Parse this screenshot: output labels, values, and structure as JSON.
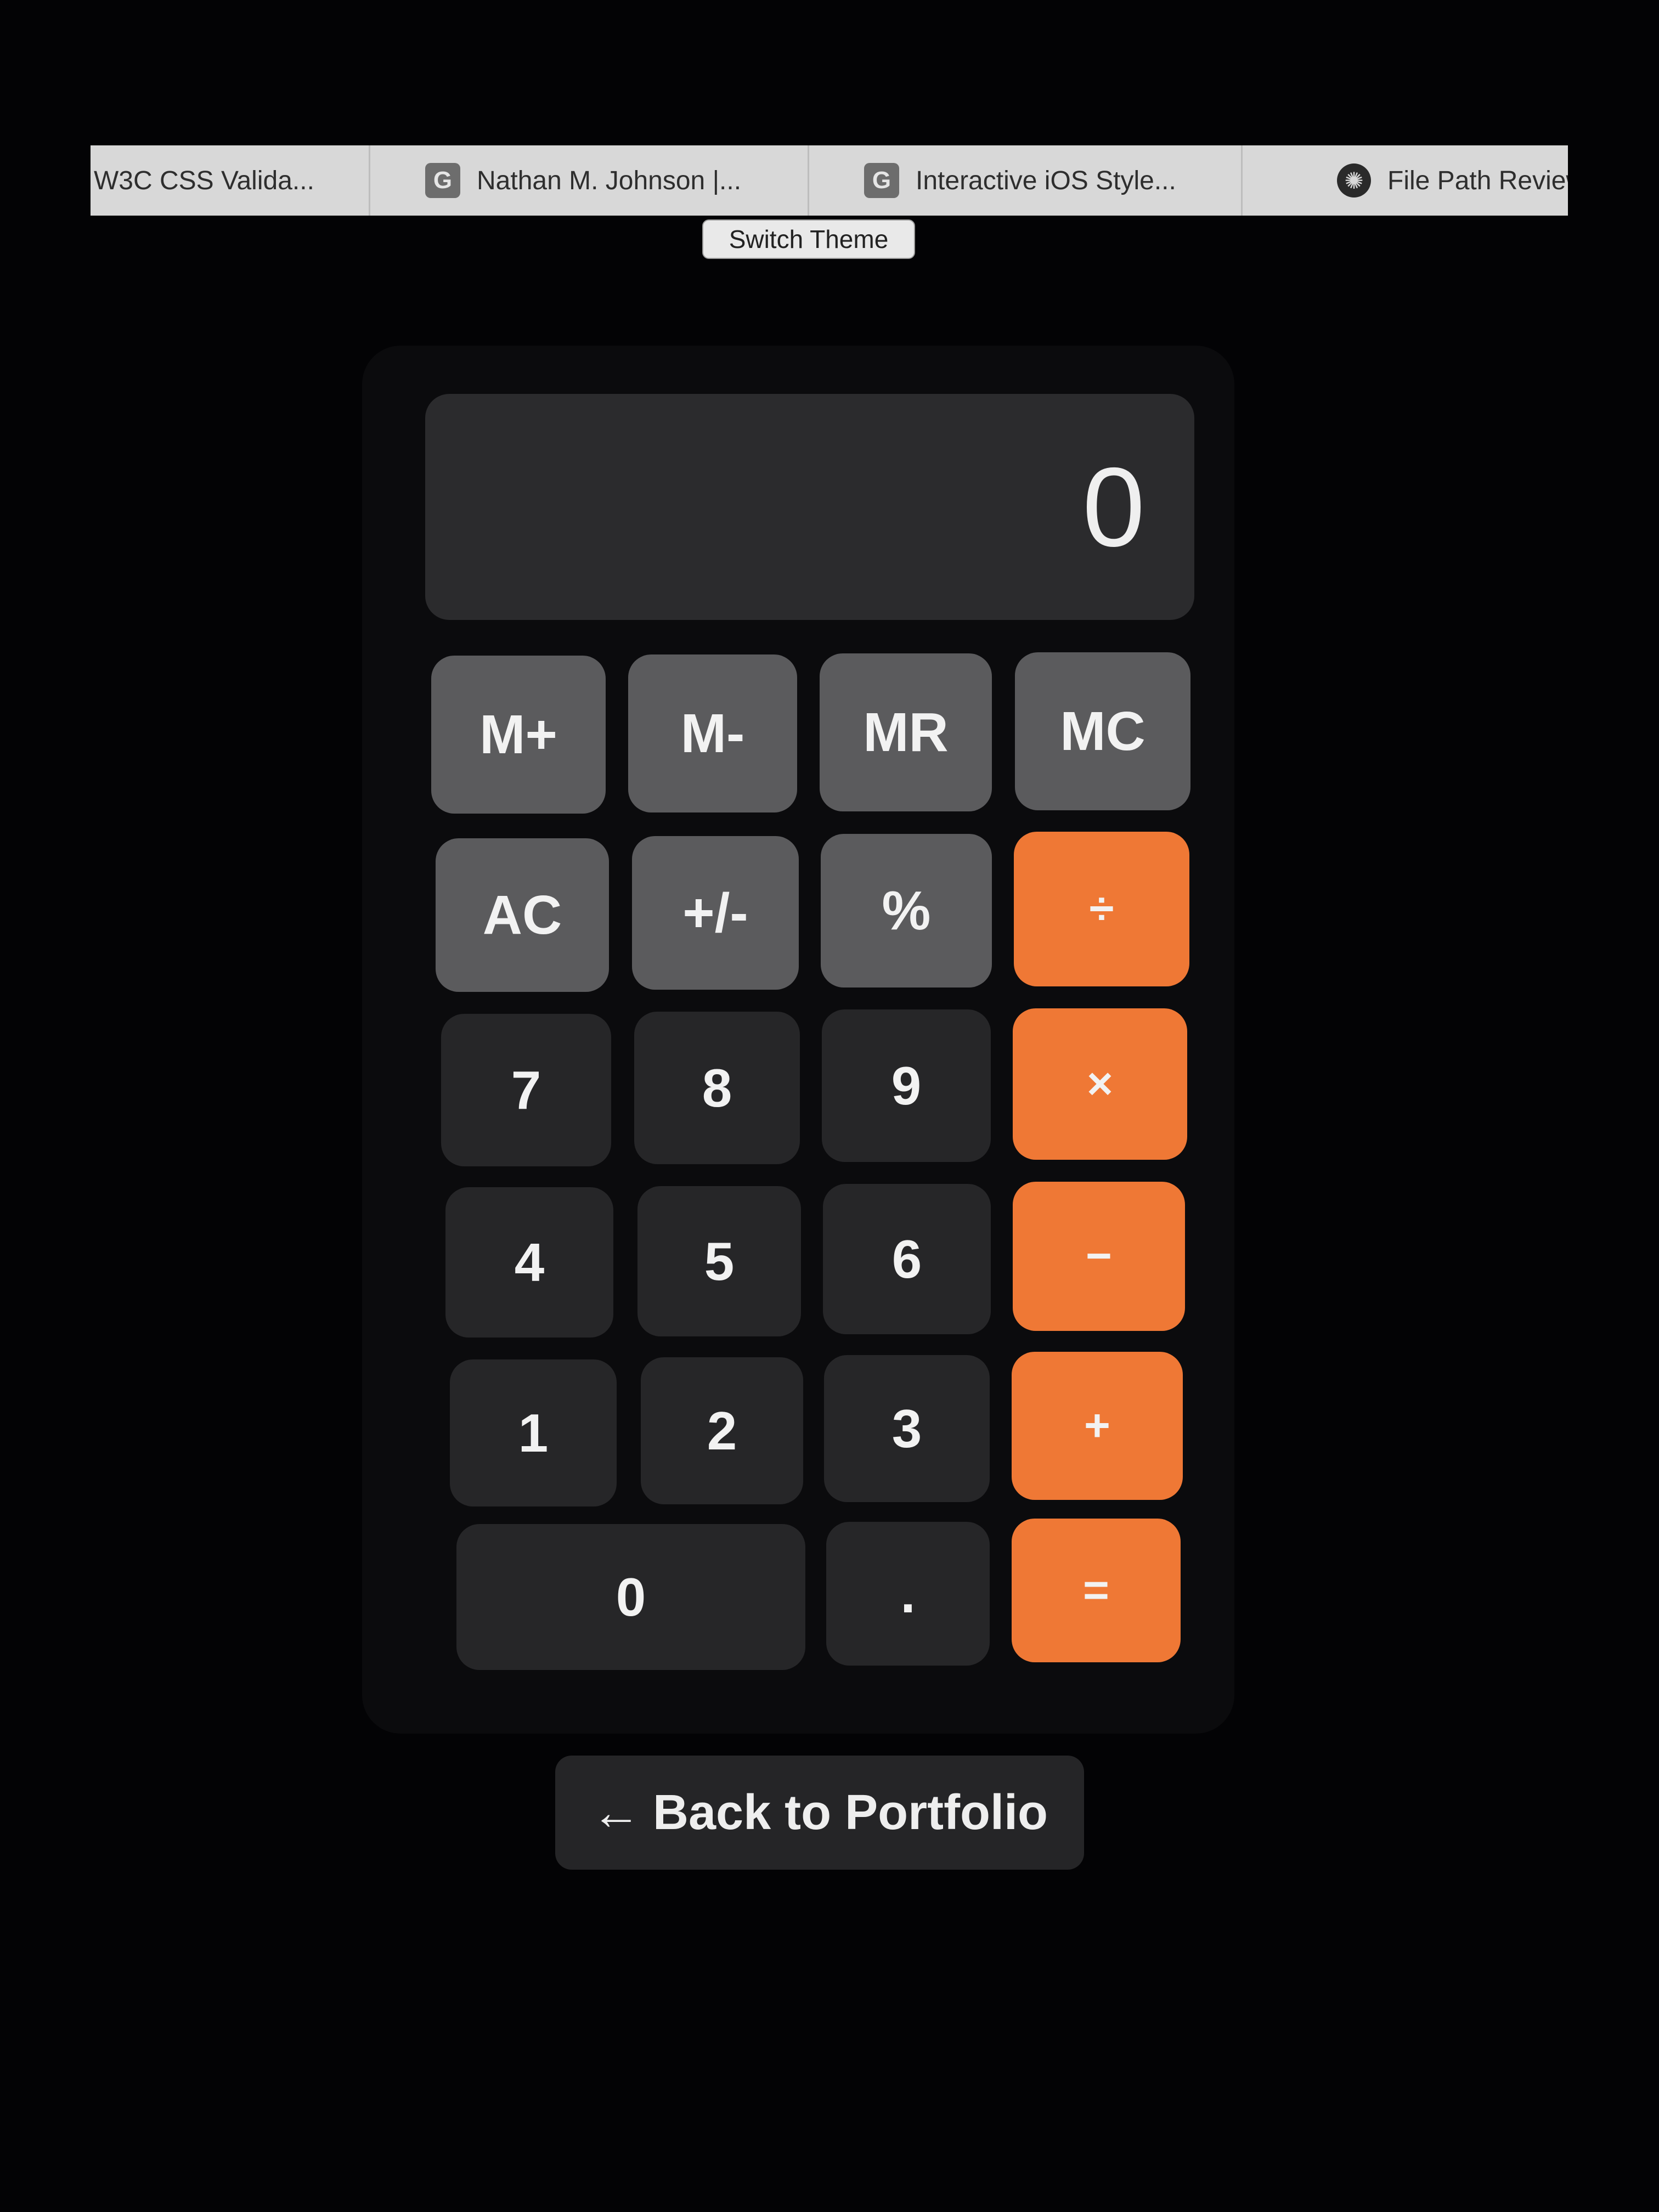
{
  "browser": {
    "tabs": [
      {
        "label": "W3C CSS Valida...",
        "icon": ""
      },
      {
        "label": "Nathan M. Johnson |...",
        "icon": "G"
      },
      {
        "label": "Interactive iOS Style...",
        "icon": "G"
      },
      {
        "label": "File Path Review",
        "icon": "ai-logo-icon"
      }
    ]
  },
  "theme": {
    "switch_label": "Switch Theme"
  },
  "calculator": {
    "display_value": "0",
    "memory_keys": [
      "M+",
      "M-",
      "MR",
      "MC"
    ],
    "function_keys": [
      "AC",
      "+/-",
      "%"
    ],
    "operators": [
      "÷",
      "×",
      "−",
      "+",
      "="
    ],
    "digits": [
      "7",
      "8",
      "9",
      "4",
      "5",
      "6",
      "1",
      "2",
      "3",
      "0",
      "."
    ],
    "colors": {
      "display_bg": "#2b2b2d",
      "function_key": "#5b5b5d",
      "digit_key": "#262628",
      "operator_key": "#ef7835"
    }
  },
  "footer": {
    "back_arrow": "←",
    "back_label": "Back to Portfolio"
  }
}
